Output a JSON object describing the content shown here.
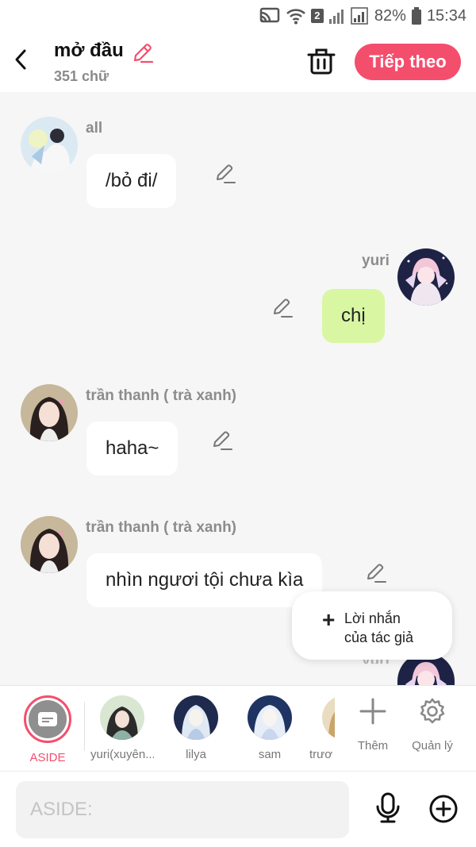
{
  "status": {
    "sim": "2",
    "battery": "82%",
    "time": "15:34"
  },
  "header": {
    "title": "mở đầu",
    "word_count": "351 chữ",
    "next_label": "Tiếp theo"
  },
  "messages": [
    {
      "name": "all",
      "text": "/bỏ đi/"
    },
    {
      "name": "yuri",
      "text": "chị"
    },
    {
      "name": "trần thanh ( trà xanh)",
      "text": "haha~"
    },
    {
      "name": "trần thanh ( trà xanh)",
      "text": "nhìn ngươi tội chưa kìa"
    },
    {
      "name": "yuri"
    }
  ],
  "popup": {
    "line1": "Lời nhắn",
    "line2": "của tác giả"
  },
  "characters": [
    {
      "label": "ASIDE"
    },
    {
      "label": "yuri(xuyên..."
    },
    {
      "label": "lilya"
    },
    {
      "label": "sam"
    },
    {
      "label": "trươ"
    }
  ],
  "tools": {
    "more_label": "Thêm",
    "manage_label": "Quản lý"
  },
  "input": {
    "placeholder": "ASIDE:"
  },
  "colors": {
    "accent": "#f44e6d",
    "bubble_self": "#d9f7a3",
    "bubble_other": "#ffffff",
    "background": "#f6f6f6"
  }
}
